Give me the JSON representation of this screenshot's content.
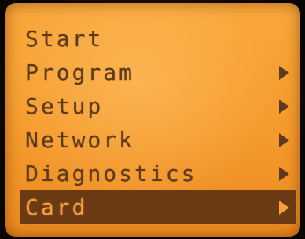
{
  "menu": {
    "items": [
      {
        "label": "Start",
        "has_submenu": false,
        "selected": false
      },
      {
        "label": "Program",
        "has_submenu": true,
        "selected": false
      },
      {
        "label": "Setup",
        "has_submenu": true,
        "selected": false
      },
      {
        "label": "Network",
        "has_submenu": true,
        "selected": false
      },
      {
        "label": "Diagnostics",
        "has_submenu": true,
        "selected": false
      },
      {
        "label": "Card",
        "has_submenu": true,
        "selected": true
      }
    ]
  },
  "colors": {
    "screen_background": "#f59a2c",
    "text": "#5b3a1e",
    "selection_background": "#6b3a14",
    "selection_text": "#f4a13b"
  },
  "icons": {
    "submenu": "triangle-right-icon"
  }
}
